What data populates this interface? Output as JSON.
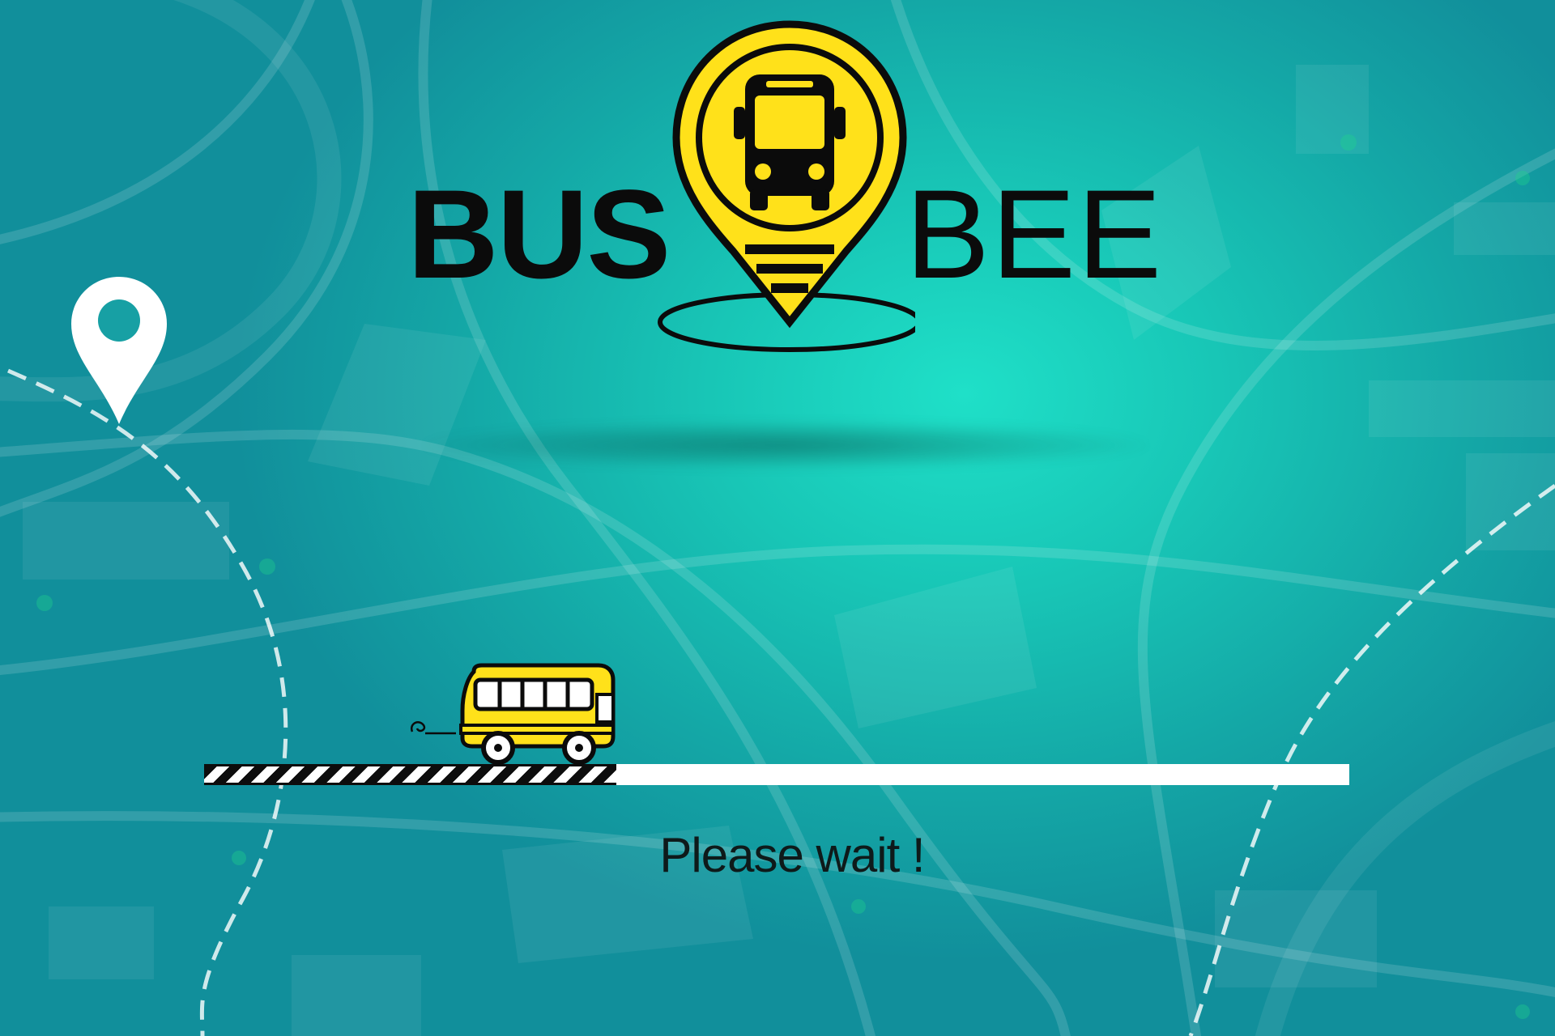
{
  "app": {
    "brand_left": "BUS",
    "brand_right": "BEE"
  },
  "loader": {
    "progress": 0.36,
    "status_text": "Please wait !"
  },
  "colors": {
    "accent_yellow": "#ffe11a",
    "ink": "#0b0b0b",
    "background_teal": "#17a9a5"
  },
  "icons": {
    "logo": "map-pin-bus-icon",
    "location": "location-pin-icon",
    "vehicle": "school-bus-icon"
  }
}
